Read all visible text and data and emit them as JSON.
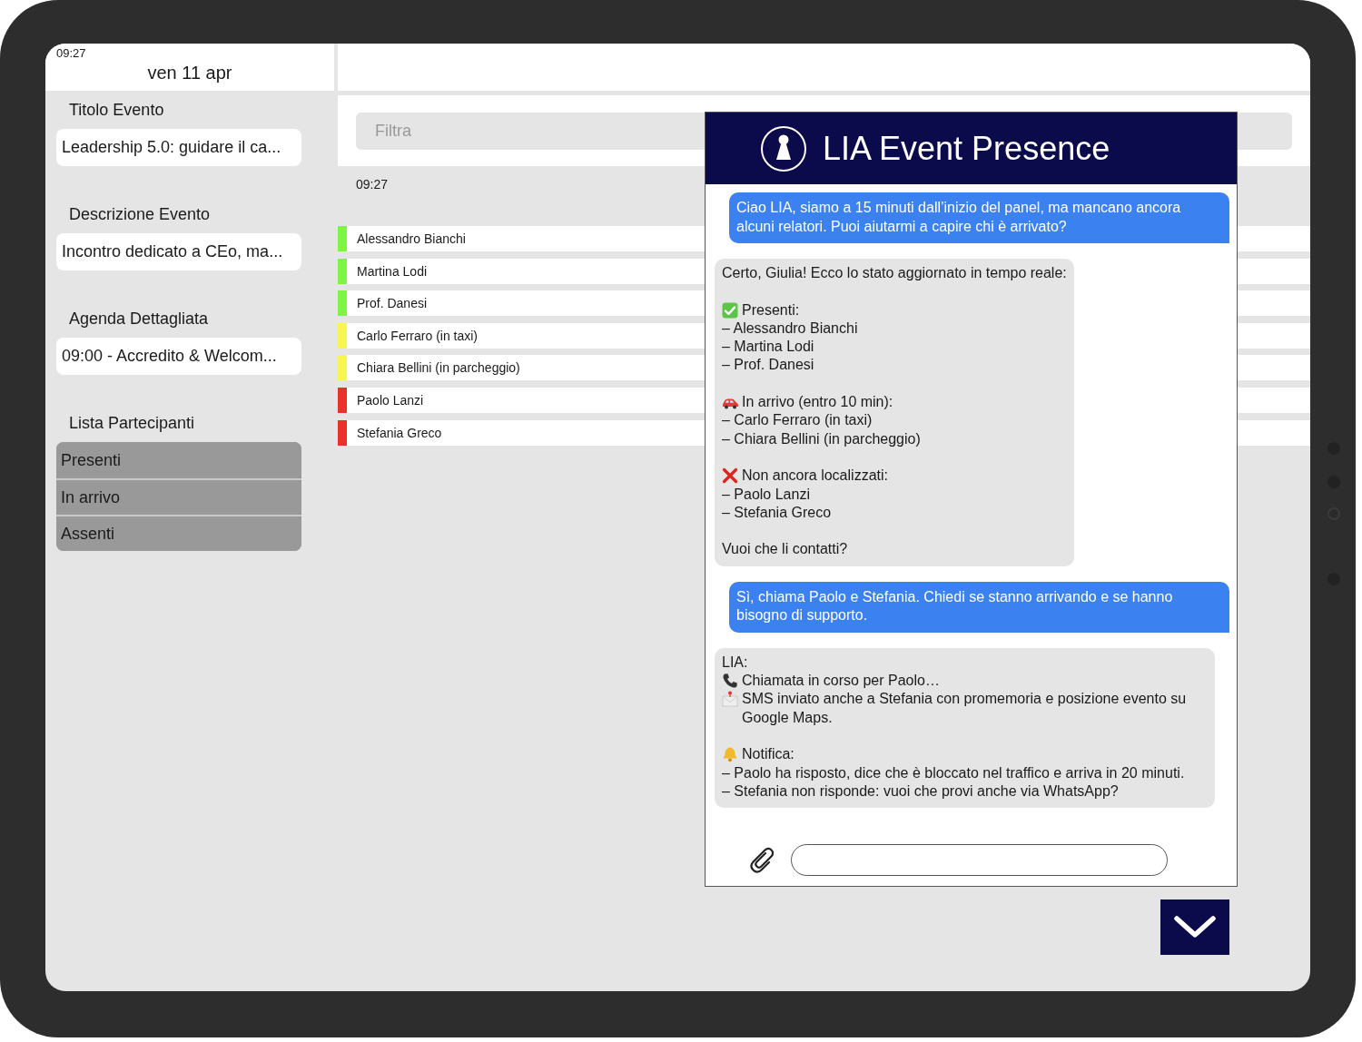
{
  "status": {
    "time": "09:27",
    "date": "ven 11 apr"
  },
  "sidebar": {
    "sections": [
      {
        "label": "Titolo Evento",
        "value": "Leadership 5.0: guidare il ca..."
      },
      {
        "label": "Descrizione Evento",
        "value": "Incontro dedicato a CEo, ma..."
      },
      {
        "label": "Agenda Dettagliata",
        "value": "09:00 - Accredito & Welcom..."
      }
    ],
    "participants": {
      "label": "Lista Partecipanti",
      "filters": [
        "Presenti",
        "In arrivo",
        "Assenti"
      ]
    }
  },
  "main": {
    "filter": {
      "placeholder": "Filtra"
    },
    "time": "09:27",
    "participants": [
      {
        "name": "Alessandro Bianchi",
        "color": "#7ef542"
      },
      {
        "name": "Martina Lodi",
        "color": "#7ef542"
      },
      {
        "name": "Prof. Danesi",
        "color": "#7ef542"
      },
      {
        "name": "Carlo Ferraro (in taxi)",
        "color": "#f8f552"
      },
      {
        "name": "Chiara Bellini (in parcheggio)",
        "color": "#f8f552"
      },
      {
        "name": "Paolo Lanzi",
        "color": "#e8322a"
      },
      {
        "name": "Stefania Greco",
        "color": "#e8322a"
      }
    ]
  },
  "chat": {
    "title": "LIA Event Presence",
    "messages": [
      {
        "kind": "user",
        "text": "Ciao LIA, siamo a 15 minuti dall’inizio del panel, ma mancano ancora alcuni relatori. Puoi aiutarmi a capire chi è arrivato?"
      },
      {
        "kind": "bot",
        "blocks": [
          {
            "lines": [
              {
                "kind": "plain",
                "text": "Certo, Giulia! Ecco lo stato aggiornato in tempo reale:"
              }
            ]
          },
          {
            "lines": [
              {
                "kind": "check",
                "text": "Presenti:"
              },
              {
                "kind": "plain",
                "text": "– Alessandro Bianchi"
              },
              {
                "kind": "plain",
                "text": "– Martina Lodi"
              },
              {
                "kind": "plain",
                "text": "– Prof. Danesi"
              }
            ]
          },
          {
            "lines": [
              {
                "kind": "car",
                "text": "In arrivo (entro 10 min):"
              },
              {
                "kind": "plain",
                "text": "– Carlo Ferraro (in taxi)"
              },
              {
                "kind": "plain",
                "text": "– Chiara Bellini (in parcheggio)"
              }
            ]
          },
          {
            "lines": [
              {
                "kind": "cross",
                "text": "Non ancora localizzati:"
              },
              {
                "kind": "plain",
                "text": "– Paolo Lanzi"
              },
              {
                "kind": "plain",
                "text": "– Stefania Greco"
              }
            ]
          },
          {
            "lines": [
              {
                "kind": "plain",
                "text": "Vuoi che li contatti?"
              }
            ]
          }
        ]
      },
      {
        "kind": "user",
        "text": "Sì, chiama Paolo e Stefania. Chiedi se stanno arrivando e se hanno bisogno di supporto."
      },
      {
        "kind": "bot",
        "blocks": [
          {
            "lines": [
              {
                "kind": "plain",
                "text": "LIA:"
              },
              {
                "kind": "phone",
                "text": "Chiamata in corso per Paolo…"
              },
              {
                "kind": "mail",
                "text": "SMS inviato anche a Stefania con promemoria e posizione evento su Google Maps."
              }
            ]
          },
          {
            "lines": [
              {
                "kind": "bell",
                "text": "Notifica:"
              },
              {
                "kind": "plain",
                "text": "– Paolo ha risposto, dice che è bloccato nel traffico e arriva in 20 minuti."
              },
              {
                "kind": "plain",
                "text": "– Stefania non risponde: vuoi che provi anche via WhatsApp?"
              }
            ]
          }
        ]
      }
    ]
  }
}
